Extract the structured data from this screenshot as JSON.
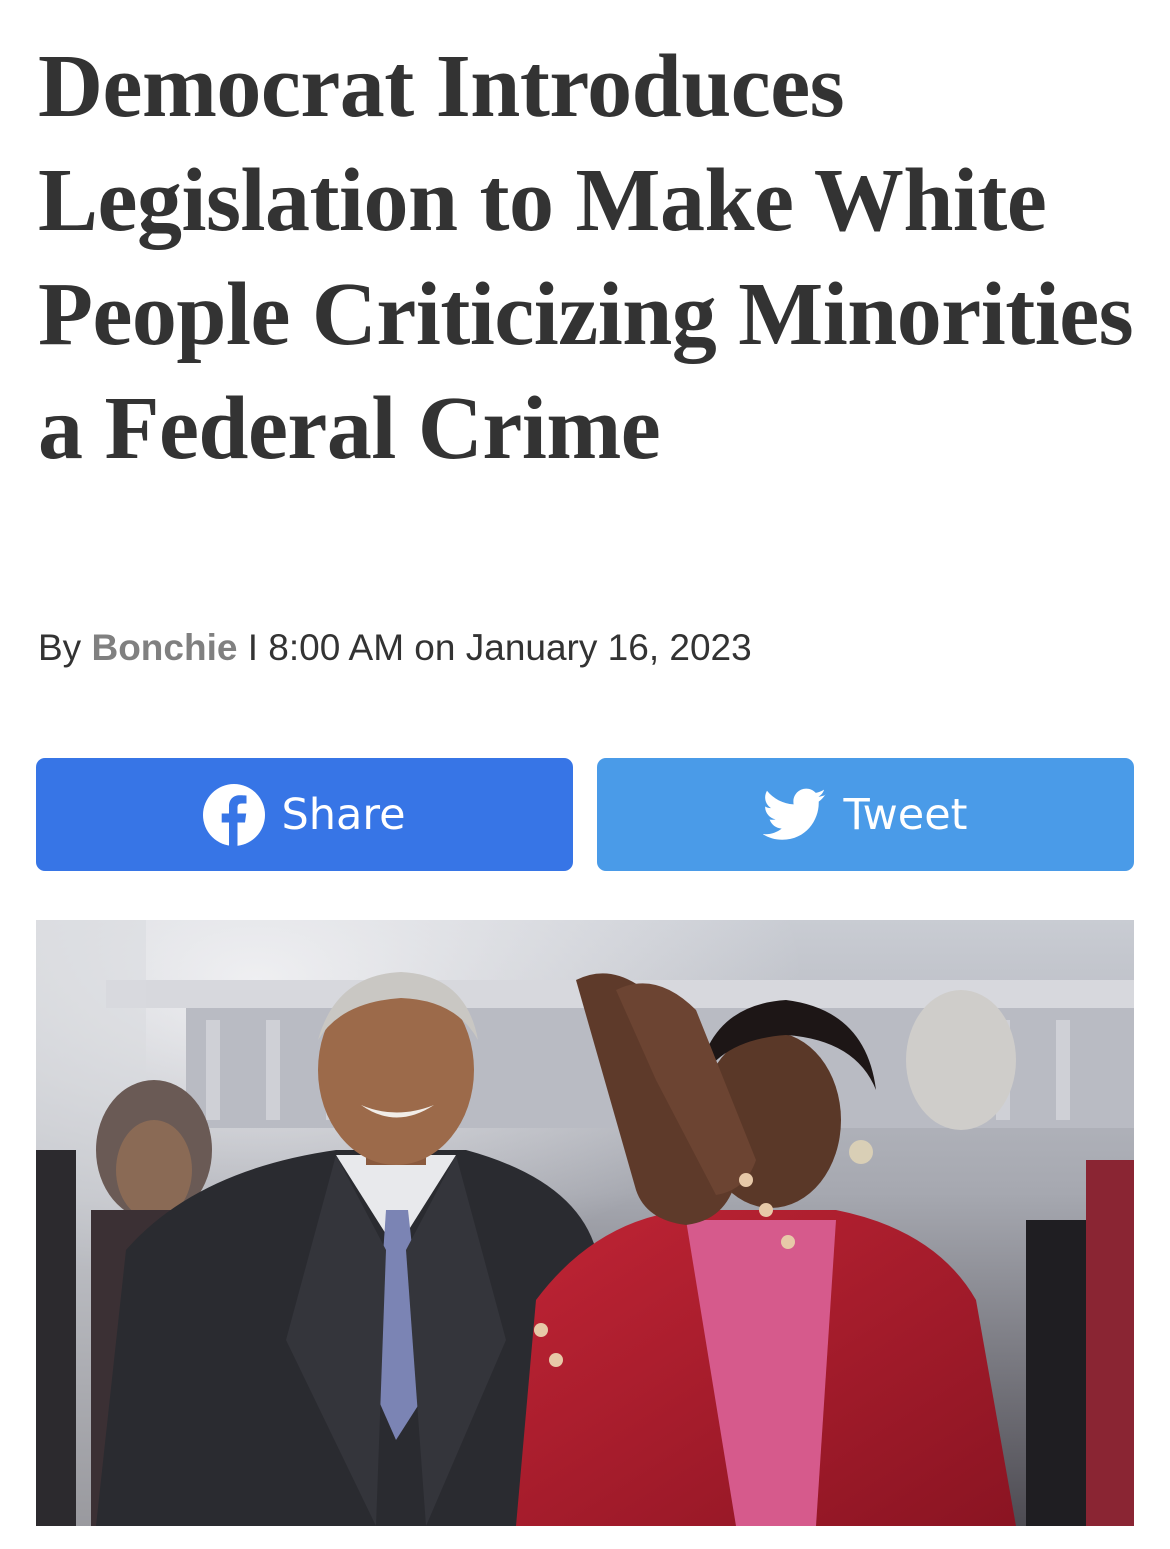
{
  "article": {
    "headline": "Democrat Introduces Legislation to Make White People Criticizing Minorities a Federal Crime",
    "byline": {
      "prefix": "By",
      "author": "Bonchie",
      "separator": "I",
      "time": "8:00 AM on January 16, 2023"
    }
  },
  "social": {
    "share_label": "Share",
    "tweet_label": "Tweet",
    "share_icon": "facebook-icon",
    "tweet_icon": "twitter-bird-icon",
    "share_color": "#3775e6",
    "tweet_color": "#4a9be8"
  },
  "colors": {
    "headline": "#333333",
    "byline_author": "#808080",
    "background": "#ffffff"
  }
}
